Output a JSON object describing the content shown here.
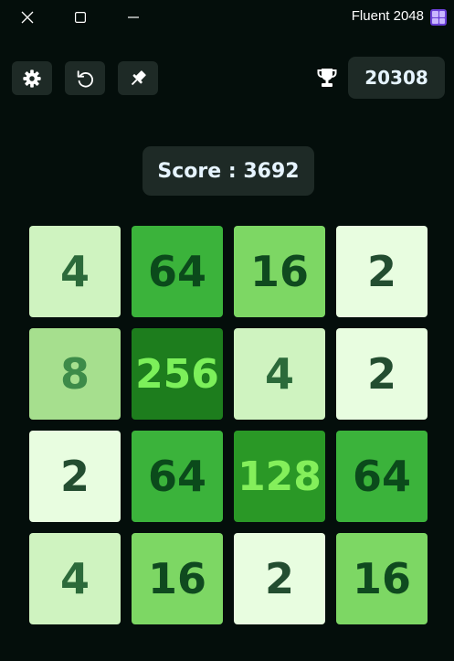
{
  "window": {
    "title": "Fluent 2048",
    "logo_icon": "app-logo-icon",
    "buttons": [
      "close-icon",
      "maximize-icon",
      "minimize-icon"
    ]
  },
  "toolbar": {
    "settings_icon": "gear-icon",
    "undo_icon": "undo-icon",
    "pin_icon": "pin-icon"
  },
  "best": {
    "icon": "trophy-icon",
    "value": "20308"
  },
  "score": {
    "label": "Score",
    "separator": " : ",
    "value": "3692"
  },
  "board": {
    "size": 4,
    "tiles": [
      [
        "4",
        "64",
        "16",
        "2"
      ],
      [
        "8",
        "256",
        "4",
        "2"
      ],
      [
        "2",
        "64",
        "128",
        "64"
      ],
      [
        "4",
        "16",
        "2",
        "16"
      ]
    ]
  },
  "colors": {
    "background": "#040e0b",
    "panel": "#1e2a26",
    "tile_2": "#e8fde0",
    "tile_4": "#cff3c0",
    "tile_8": "#a6df8e",
    "tile_16": "#7dd764",
    "tile_64": "#3bb33b",
    "tile_128": "#2a9826",
    "tile_256": "#1d7d1d"
  }
}
